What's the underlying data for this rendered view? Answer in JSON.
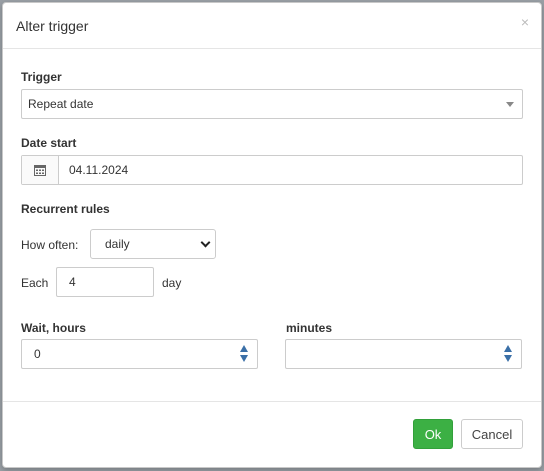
{
  "dialog": {
    "title": "Alter trigger",
    "close_glyph": "×"
  },
  "trigger": {
    "label": "Trigger",
    "value": "Repeat date"
  },
  "date_start": {
    "label": "Date start",
    "value": "04.11.2024",
    "icon": "calendar-icon"
  },
  "recurrent": {
    "label": "Recurrent rules",
    "how_often_label": "How often:",
    "how_often_value": "daily",
    "each_label": "Each",
    "each_value": "4",
    "unit_label": "day"
  },
  "wait": {
    "hours_label": "Wait, hours",
    "hours_value": "0",
    "minutes_label": "minutes",
    "minutes_value": ""
  },
  "buttons": {
    "ok": "Ok",
    "cancel": "Cancel"
  },
  "colors": {
    "ok_bg": "#3cb044",
    "spinner": "#3a6fa7"
  }
}
